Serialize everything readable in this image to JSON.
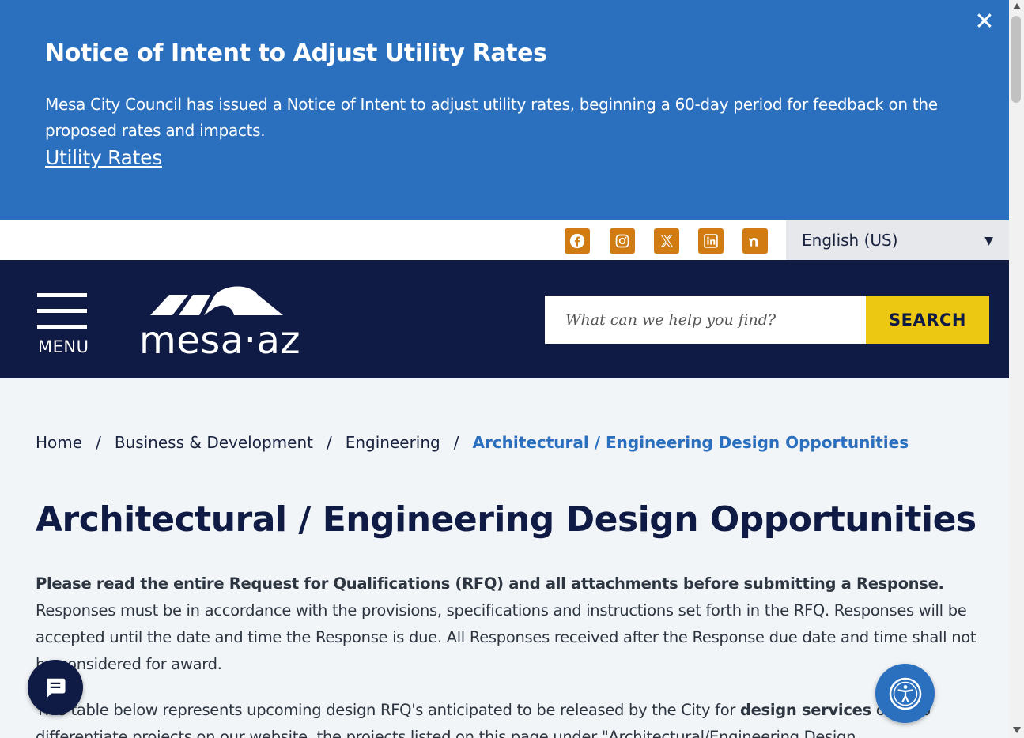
{
  "alert": {
    "title": "Notice of Intent to Adjust Utility Rates",
    "body": "Mesa City Council has issued a Notice of Intent to adjust utility rates, beginning a 60-day period for feedback on the proposed rates and impacts.",
    "link": "Utility Rates",
    "close": "✕"
  },
  "utility": {
    "social": [
      "facebook-icon",
      "instagram-icon",
      "x-icon",
      "linkedin-icon",
      "nextdoor-icon"
    ],
    "language": "English (US)"
  },
  "header": {
    "menu_label": "MENU",
    "logo_text": "mesa·az",
    "search_placeholder": "What can we help you find?",
    "search_button": "SEARCH"
  },
  "breadcrumb": {
    "items": [
      "Home",
      "Business & Development",
      "Engineering"
    ],
    "current": "Architectural / Engineering Design Opportunities",
    "separator": "/"
  },
  "page": {
    "title": "Architectural / Engineering Design Opportunities",
    "para1_bold": "Please read the entire Request for Qualifications (RFQ) and all attachments before submitting a Response.",
    "para1_rest": "Responses must be in accordance with the provisions, specifications and instructions set forth in the RFQ. Responses will be accepted until the date and time the Response is due. All Responses received after the Response due date and time shall not be considered for award.",
    "para2_start": "This table below represents upcoming design RFQ's anticipated to be released by the City for ",
    "para2_bold": "design services",
    "para2_end": " only. To differentiate projects on our website, the projects listed on this page under \"Architectural/Engineering Design"
  },
  "colors": {
    "alert_bg": "#2b70bf",
    "header_bg": "#0f1b44",
    "social_bg": "#d07c12",
    "search_btn": "#ecc812"
  }
}
